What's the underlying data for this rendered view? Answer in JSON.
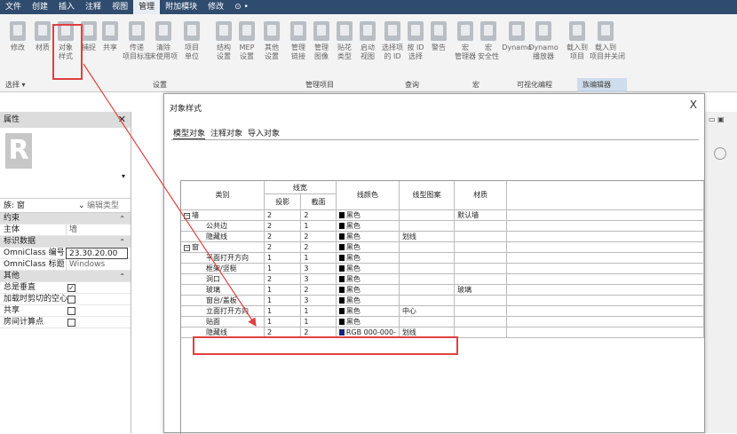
{
  "menu": [
    "文件",
    "创建",
    "插入",
    "注释",
    "视图",
    "管理",
    "附加模块",
    "修改",
    "⊙ •"
  ],
  "ribbon_buttons": [
    [
      "修改",
      ""
    ],
    [
      "材质",
      ""
    ],
    [
      "对象",
      "样式"
    ],
    [
      "捕捉",
      ""
    ],
    [
      "共享",
      ""
    ],
    [
      "传递",
      "项目标准"
    ],
    [
      "清除",
      "未使用项"
    ],
    [
      "项目",
      "单位"
    ],
    [
      "结构",
      "设置"
    ],
    [
      "MEP",
      "设置"
    ],
    [
      "其他",
      "设置"
    ],
    [
      "管理",
      "链接"
    ],
    [
      "管理",
      "图像"
    ],
    [
      "贴花",
      "类型"
    ],
    [
      "启动",
      "视图"
    ],
    [
      "选择项",
      "的 ID"
    ],
    [
      "按 ID",
      "选择"
    ],
    [
      "警告",
      ""
    ],
    [
      "宏",
      "管理器"
    ],
    [
      "宏",
      "安全性"
    ],
    [
      "Dynamo",
      ""
    ],
    [
      "Dynamo",
      "播放器"
    ],
    [
      "载入到",
      "项目"
    ],
    [
      "载入到",
      "项目并关闭"
    ]
  ],
  "ribbon_group_labels": [
    "选择 ▾",
    "设置",
    "管理项目",
    "查询",
    "宏",
    "可视化编程",
    "族编辑器"
  ],
  "properties": {
    "title": "属性",
    "close": "✕",
    "logo": "R",
    "type_label": "族: 窗",
    "edit_type": "编辑类型",
    "sections": [
      {
        "title": "约束",
        "rows": [
          [
            "主体",
            "墙"
          ]
        ]
      },
      {
        "title": "标识数据",
        "rows": [
          [
            "OmniClass 编号",
            "23.30.20.00"
          ],
          [
            "OmniClass 标题",
            "Windows"
          ]
        ]
      },
      {
        "title": "其他",
        "checks": [
          [
            "总是垂直",
            true
          ],
          [
            "加载时剪切的空心",
            false
          ],
          [
            "共享",
            false
          ],
          [
            "房间计算点",
            false
          ]
        ]
      }
    ]
  },
  "dialog": {
    "title": "对象样式",
    "close": "X",
    "tabs": [
      "模型对象",
      "注释对象",
      "导入对象"
    ],
    "headers": {
      "category": "类别",
      "line_width": "线宽",
      "projection": "投影",
      "cut": "截面",
      "line_color": "线颜色",
      "line_pattern": "线型图案",
      "material": "材质"
    },
    "rows": [
      {
        "name": "墙",
        "level": 0,
        "tree": "−",
        "proj": "2",
        "cut": "2",
        "color": "黑色",
        "swatch": "#000000",
        "pattern": "",
        "material": "默认墙"
      },
      {
        "name": "公共边",
        "level": 1,
        "proj": "2",
        "cut": "1",
        "color": "黑色",
        "swatch": "#000000",
        "pattern": "",
        "material": ""
      },
      {
        "name": "隐藏线",
        "level": 1,
        "proj": "2",
        "cut": "2",
        "color": "黑色",
        "swatch": "#000000",
        "pattern": "划线",
        "material": ""
      },
      {
        "name": "窗",
        "level": 0,
        "tree": "−",
        "proj": "2",
        "cut": "2",
        "color": "黑色",
        "swatch": "#000000",
        "pattern": "",
        "material": ""
      },
      {
        "name": "平面打开方向",
        "level": 1,
        "proj": "1",
        "cut": "1",
        "color": "黑色",
        "swatch": "#000000",
        "pattern": "",
        "material": ""
      },
      {
        "name": "框架/竖梃",
        "level": 1,
        "proj": "1",
        "cut": "3",
        "color": "黑色",
        "swatch": "#000000",
        "pattern": "",
        "material": ""
      },
      {
        "name": "洞口",
        "level": 1,
        "proj": "2",
        "cut": "3",
        "color": "黑色",
        "swatch": "#000000",
        "pattern": "",
        "material": ""
      },
      {
        "name": "玻璃",
        "level": 1,
        "proj": "1",
        "cut": "2",
        "color": "黑色",
        "swatch": "#000000",
        "pattern": "",
        "material": "玻璃"
      },
      {
        "name": "窗台/盖板",
        "level": 1,
        "proj": "1",
        "cut": "3",
        "color": "黑色",
        "swatch": "#000000",
        "pattern": "",
        "material": ""
      },
      {
        "name": "立面打开方向",
        "level": 1,
        "proj": "1",
        "cut": "1",
        "color": "黑色",
        "swatch": "#000000",
        "pattern": "中心",
        "material": ""
      },
      {
        "name": "贴面",
        "level": 1,
        "proj": "1",
        "cut": "1",
        "color": "黑色",
        "swatch": "#000000",
        "pattern": "",
        "material": ""
      },
      {
        "name": "隐藏线",
        "level": 1,
        "proj": "2",
        "cut": "2",
        "color": "RGB 000-000-",
        "swatch": "#1a237e",
        "pattern": "划线",
        "material": ""
      }
    ]
  },
  "colors": {
    "highlight": "#e04040",
    "menubar": "#2f4b6e"
  }
}
